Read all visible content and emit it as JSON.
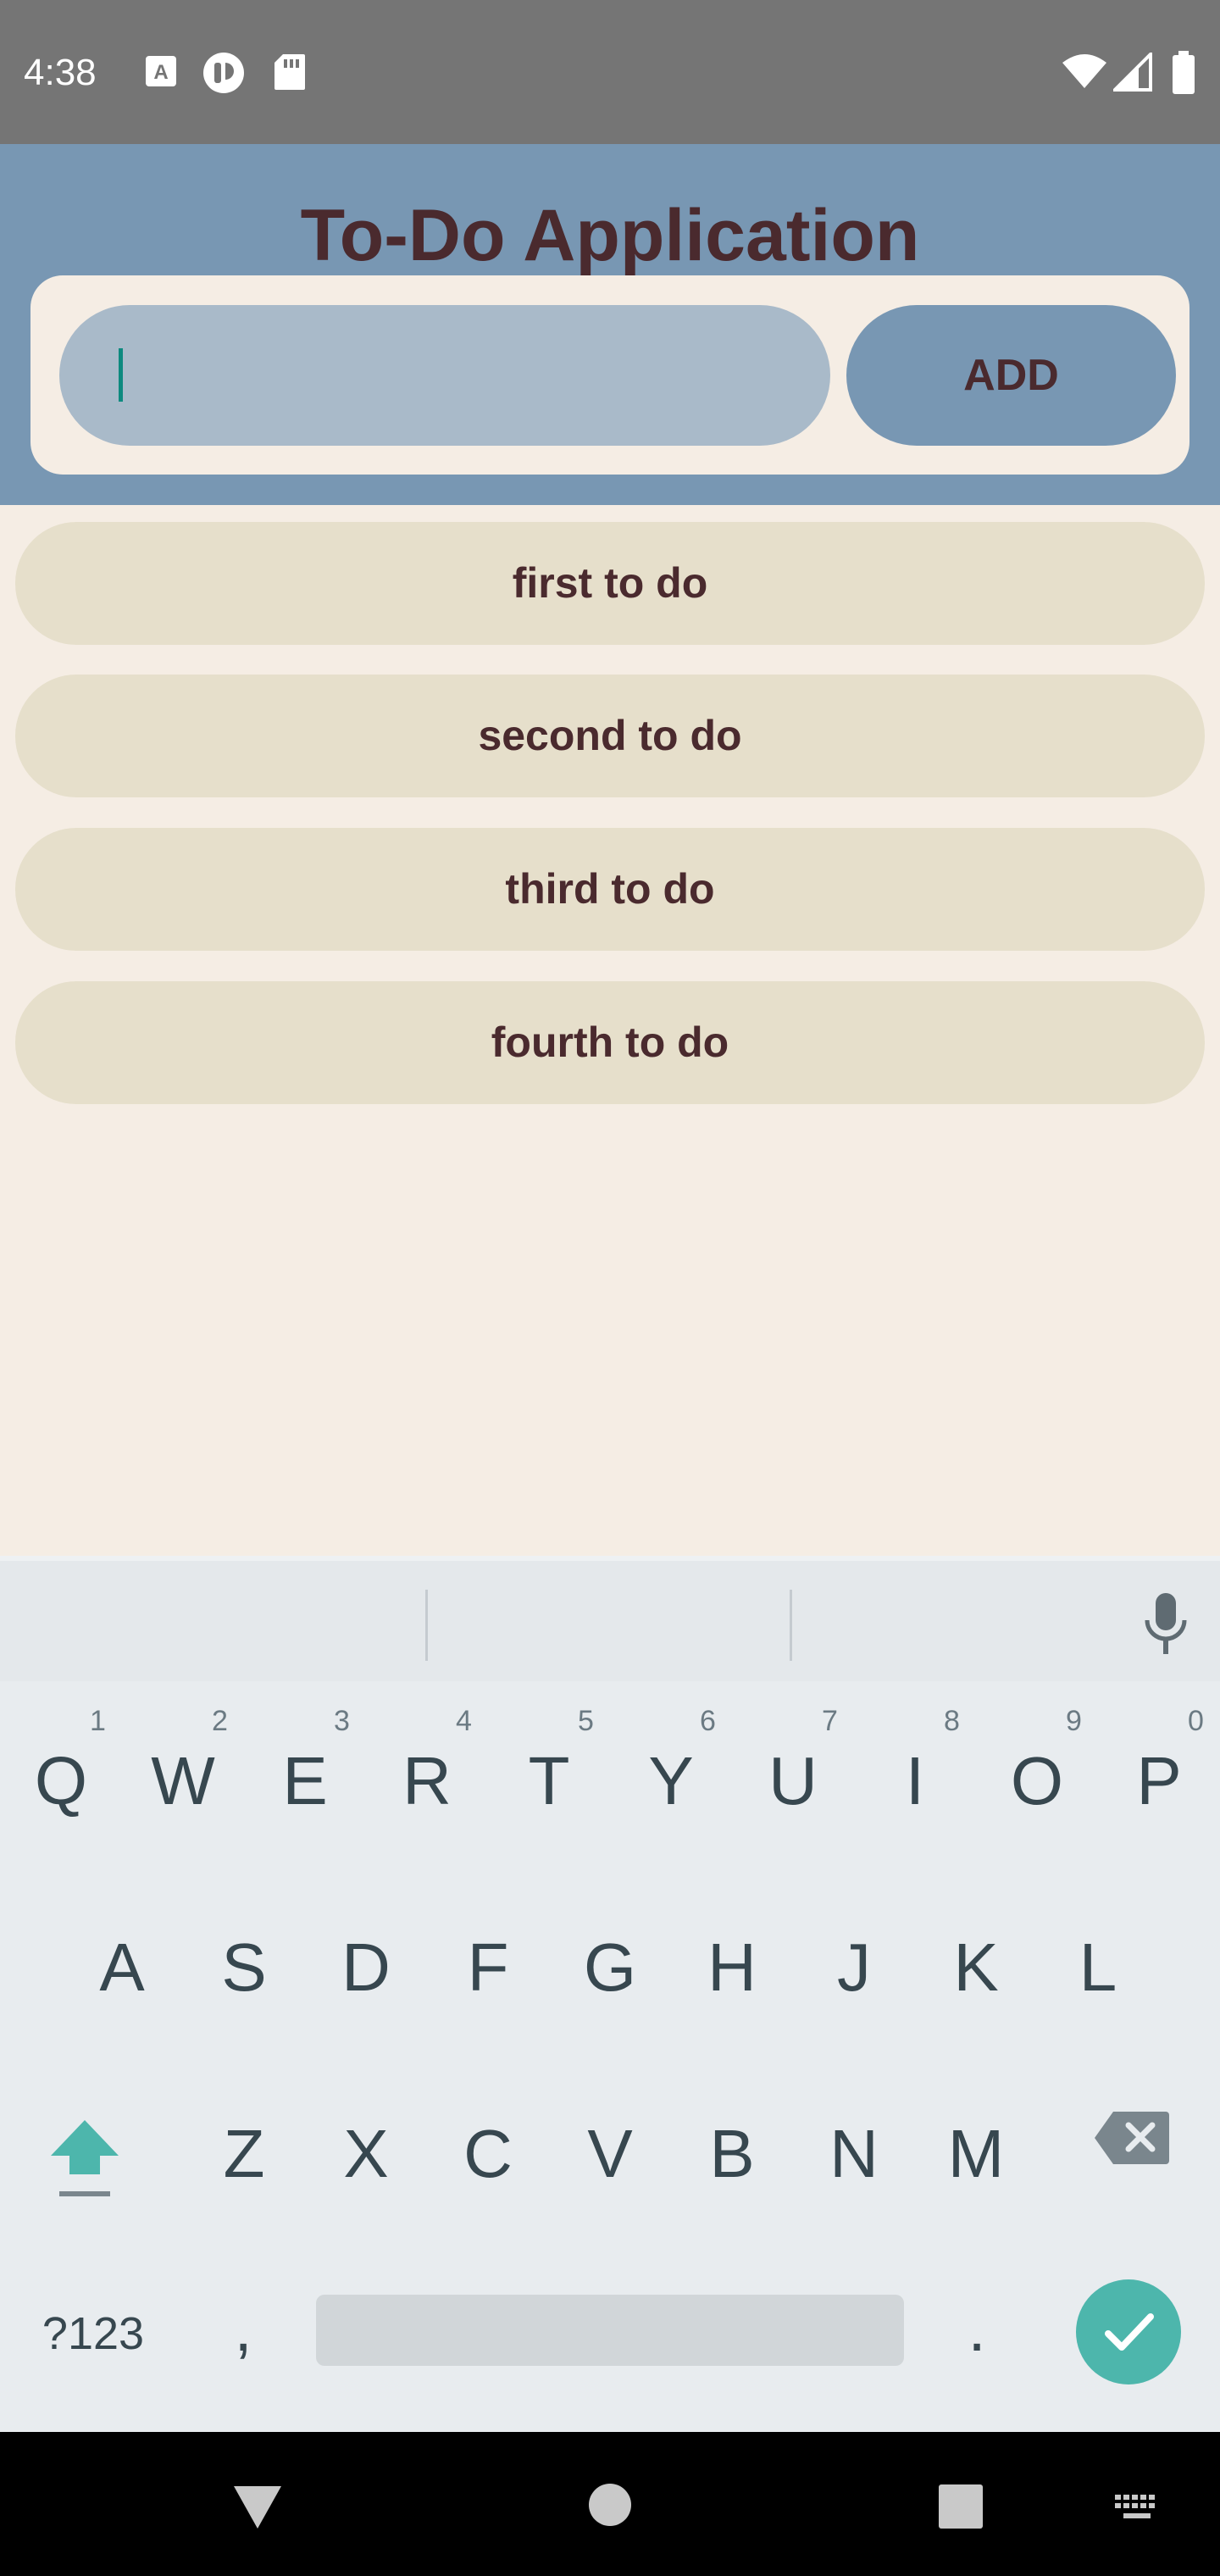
{
  "status_bar": {
    "time": "4:38",
    "left_icons": [
      "a-badge-icon",
      "hearing-icon",
      "sd-card-icon"
    ],
    "right_icons": [
      "wifi-icon",
      "signal-icon",
      "battery-icon"
    ]
  },
  "app": {
    "title": "To-Do Application",
    "input": {
      "value": "",
      "placeholder": ""
    },
    "add_label": "ADD",
    "todos": [
      {
        "label": "first to do"
      },
      {
        "label": "second to do"
      },
      {
        "label": "third to do"
      },
      {
        "label": "fourth to do"
      }
    ],
    "colors": {
      "header_bg": "#7897b3",
      "page_bg": "#f5ede4",
      "input_bg": "#a9bac9",
      "item_bg": "#e6dfcb",
      "text": "#4a2a2e"
    }
  },
  "keyboard": {
    "row1": [
      {
        "key": "Q",
        "hint": "1"
      },
      {
        "key": "W",
        "hint": "2"
      },
      {
        "key": "E",
        "hint": "3"
      },
      {
        "key": "R",
        "hint": "4"
      },
      {
        "key": "T",
        "hint": "5"
      },
      {
        "key": "Y",
        "hint": "6"
      },
      {
        "key": "U",
        "hint": "7"
      },
      {
        "key": "I",
        "hint": "8"
      },
      {
        "key": "O",
        "hint": "9"
      },
      {
        "key": "P",
        "hint": "0"
      }
    ],
    "row2": [
      "A",
      "S",
      "D",
      "F",
      "G",
      "H",
      "J",
      "K",
      "L"
    ],
    "row3": [
      "Z",
      "X",
      "C",
      "V",
      "B",
      "N",
      "M"
    ],
    "symbols_label": "?123",
    "comma": ",",
    "period": ".",
    "accent_color": "#4db6ac"
  },
  "nav_bar": {
    "icons": [
      "back-icon",
      "home-icon",
      "recents-icon",
      "keyboard-switch-icon"
    ]
  }
}
